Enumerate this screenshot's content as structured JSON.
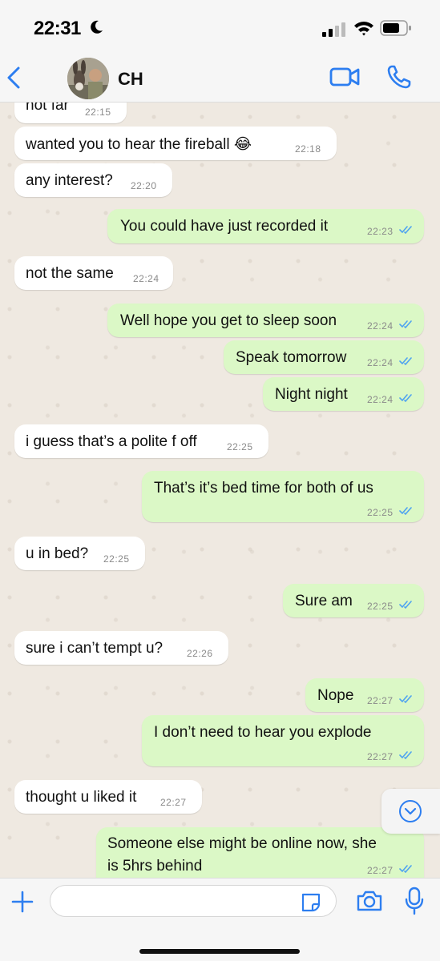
{
  "status_bar": {
    "time": "22:31"
  },
  "header": {
    "contact_name": "CH",
    "icons": {
      "back": "chevron-left-icon",
      "video": "video-camera-icon",
      "call": "phone-icon"
    }
  },
  "colors": {
    "accent": "#2d7ef0",
    "incoming_bubble": "#ffffff",
    "outgoing_bubble": "#dbf8c6",
    "chat_background": "#efe9e1",
    "read_tick": "#4fa3f0"
  },
  "messages": [
    {
      "direction": "in",
      "text": "not far",
      "time": "22:15"
    },
    {
      "direction": "in",
      "text": "wanted you to hear the fireball 😂",
      "time": "22:18"
    },
    {
      "direction": "in",
      "text": "any interest?",
      "time": "22:20"
    },
    {
      "direction": "out",
      "text": "You could have just recorded it",
      "time": "22:23",
      "read": true
    },
    {
      "direction": "in",
      "text": "not the same",
      "time": "22:24"
    },
    {
      "direction": "out",
      "text": "Well hope you get to sleep soon",
      "time": "22:24",
      "read": true
    },
    {
      "direction": "out",
      "text": "Speak tomorrow",
      "time": "22:24",
      "read": true
    },
    {
      "direction": "out",
      "text": "Night night",
      "time": "22:24",
      "read": true
    },
    {
      "direction": "in",
      "text": "i guess that’s a polite f off",
      "time": "22:25"
    },
    {
      "direction": "out",
      "text": "That’s it’s bed time for both of us",
      "time": "22:25",
      "read": true
    },
    {
      "direction": "in",
      "text": "u in bed?",
      "time": "22:25"
    },
    {
      "direction": "out",
      "text": "Sure am",
      "time": "22:25",
      "read": true
    },
    {
      "direction": "in",
      "text": "sure i can’t tempt u?",
      "time": "22:26"
    },
    {
      "direction": "out",
      "text": "Nope",
      "time": "22:27",
      "read": true
    },
    {
      "direction": "out",
      "text": "I don’t need to hear you explode",
      "time": "22:27",
      "read": true
    },
    {
      "direction": "in",
      "text": "thought u liked it",
      "time": "22:27"
    },
    {
      "direction": "out",
      "text_line1": "Someone else might be online now, she",
      "text_line2": "is 5hrs behind",
      "time": "22:27",
      "read": true
    }
  ],
  "input_bar": {
    "placeholder": "",
    "icons": {
      "attach": "plus-icon",
      "sticker": "sticker-icon",
      "camera": "camera-icon",
      "voice": "microphone-icon"
    }
  }
}
